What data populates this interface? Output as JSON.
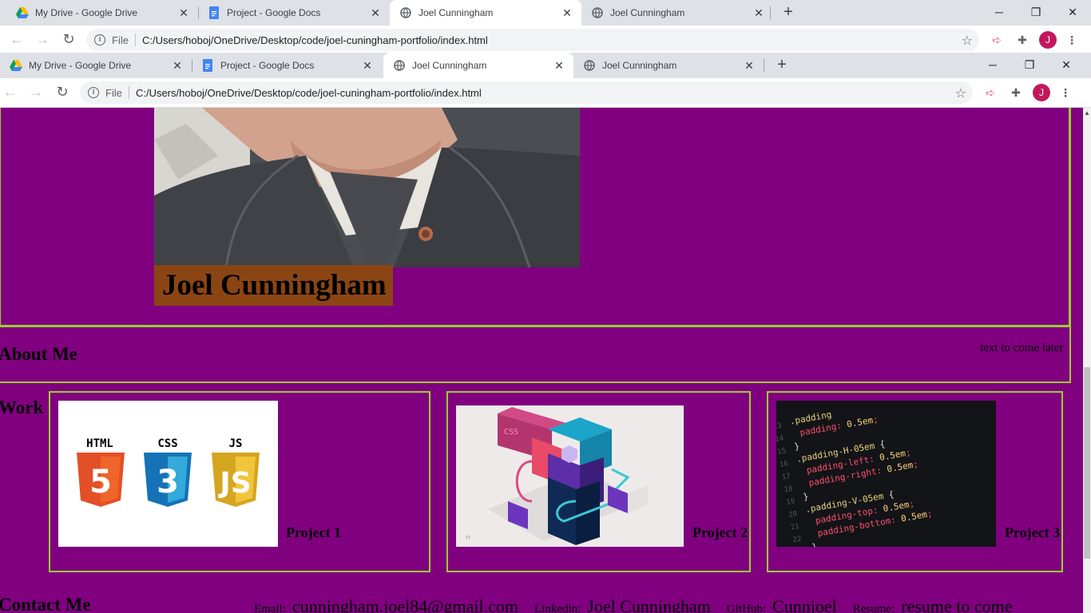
{
  "outer_browser": {
    "tabs": [
      {
        "title": "My Drive - Google Drive",
        "icon": "google-drive-icon",
        "active": false
      },
      {
        "title": "Project - Google Docs",
        "icon": "google-docs-icon",
        "active": false
      },
      {
        "title": "Joel Cunningham",
        "icon": "globe-icon",
        "active": true
      },
      {
        "title": "Joel Cunningham",
        "icon": "globe-icon",
        "active": false
      }
    ],
    "scheme": "File",
    "url": "C:/Users/hoboj/OneDrive/Desktop/code/joel-cuningham-portfolio/index.html",
    "avatar_letter": "J"
  },
  "inner_browser": {
    "tabs": [
      {
        "title": "My Drive - Google Drive",
        "icon": "google-drive-icon",
        "active": false
      },
      {
        "title": "Project - Google Docs",
        "icon": "google-docs-icon",
        "active": false
      },
      {
        "title": "Joel Cunningham",
        "icon": "globe-icon",
        "active": true
      },
      {
        "title": "Joel Cunningham",
        "icon": "globe-icon",
        "active": false
      }
    ],
    "scheme": "File",
    "url": "C:/Users/hoboj/OneDrive/Desktop/code/joel-cuningham-portfolio/index.html",
    "avatar_letter": "J"
  },
  "page": {
    "name": "Joel Cunningham",
    "about_title": "About Me",
    "about_text": "text to come later",
    "work_title": "Work",
    "projects": [
      {
        "title": "Project 1",
        "image": "html-css-js-logos"
      },
      {
        "title": "Project 2",
        "image": "isometric-css-illustration"
      },
      {
        "title": "Project 3",
        "image": "code-editor-screenshot"
      }
    ],
    "contact_title": "Contact Me",
    "contacts": [
      {
        "label": "Email:",
        "value": "cunningham.joel84@gmail.com"
      },
      {
        "label": "Linkedin:",
        "value": "Joel Cunningham"
      },
      {
        "label": "GitHub:",
        "value": "Cunnjoel"
      },
      {
        "label": "Resume:",
        "value": "resume to come"
      }
    ]
  },
  "colors": {
    "page_bg": "#800080",
    "border": "#9acd32",
    "name_bg": "#8b4513"
  }
}
